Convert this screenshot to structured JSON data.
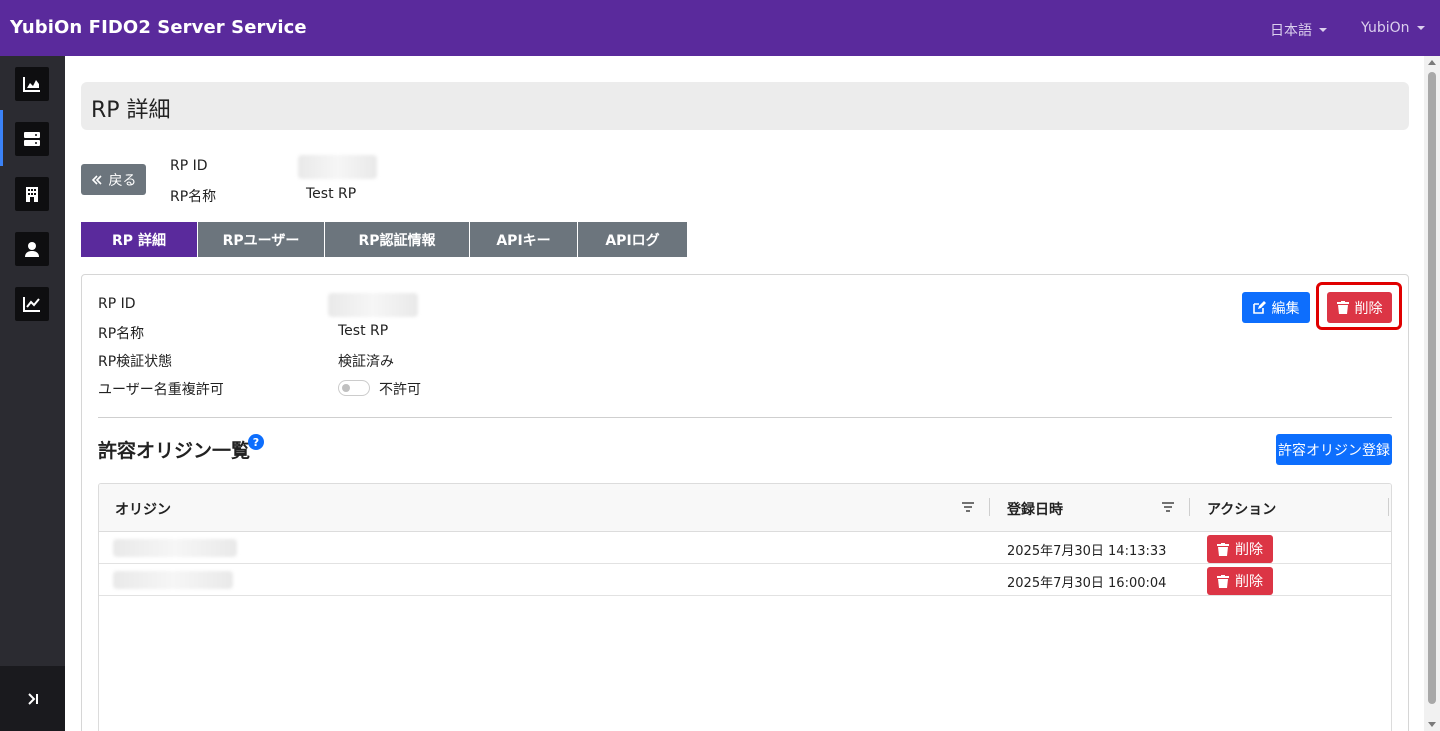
{
  "app": {
    "title": "YubiOn FIDO2 Server Service"
  },
  "topbar": {
    "language": "日本語",
    "user": "YubiOn"
  },
  "sidebar": {
    "items": [
      {
        "icon": "area-chart-icon"
      },
      {
        "icon": "server-icon",
        "active": true
      },
      {
        "icon": "building-icon"
      },
      {
        "icon": "user-icon"
      },
      {
        "icon": "line-chart-icon"
      }
    ],
    "collapse_icon": "sidebar-expand-icon"
  },
  "page": {
    "title": "RP 詳細"
  },
  "header_info": {
    "back_label": "戻る",
    "rp_id_label": "RP ID",
    "rp_name_label": "RP名称",
    "rp_name_value": "Test RP"
  },
  "tabs": [
    {
      "label": "RP 詳細",
      "active": true
    },
    {
      "label": "RPユーザー"
    },
    {
      "label": "RP認証情報"
    },
    {
      "label": "APIキー"
    },
    {
      "label": "APIログ"
    }
  ],
  "detail": {
    "rp_id_label": "RP ID",
    "rp_name_label": "RP名称",
    "rp_name_value": "Test RP",
    "verify_label": "RP検証状態",
    "verify_value": "検証済み",
    "dup_label": "ユーザー名重複許可",
    "dup_value": "不許可",
    "edit_label": "編集",
    "delete_label": "削除"
  },
  "origins": {
    "title": "許容オリジン一覧",
    "register_label": "許容オリジン登録",
    "columns": [
      "オリジン",
      "登録日時",
      "アクション"
    ],
    "rows": [
      {
        "date": "2025年7月30日 14:13:33",
        "action": "削除"
      },
      {
        "date": "2025年7月30日 16:00:04",
        "action": "削除"
      }
    ]
  },
  "colors": {
    "brand": "#5a2a9c",
    "primary": "#0d6efd",
    "danger": "#dc3545",
    "secondary": "#6c757d"
  }
}
